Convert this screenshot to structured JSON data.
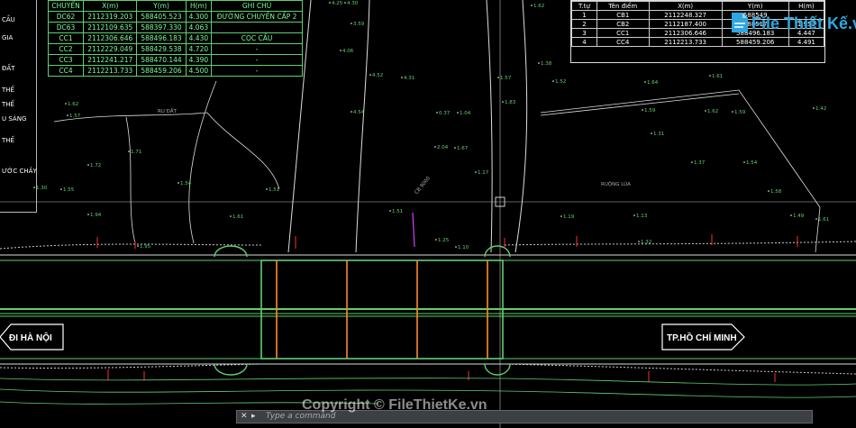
{
  "left_table": {
    "header": {
      "c1": "CHUYỂN",
      "c2": "X(m)",
      "c3": "Y(m)",
      "c4": "H(m)",
      "c5": "GHI CHÚ"
    },
    "rows": [
      {
        "c1": "DC62",
        "c2": "2112319.203",
        "c3": "588405.523",
        "c4": "4.300",
        "c5": "ĐƯỜNG CHUYỀN CẤP 2"
      },
      {
        "c1": "DC63",
        "c2": "2112109.635",
        "c3": "588397.330",
        "c4": "4.063",
        "c5": ""
      },
      {
        "c1": "CC1",
        "c2": "2112306.646",
        "c3": "588496.183",
        "c4": "4.430",
        "c5": "CỌC CẦU"
      },
      {
        "c1": "CC2",
        "c2": "2112229.049",
        "c3": "588429.538",
        "c4": "4.720",
        "c5": "-"
      },
      {
        "c1": "CC3",
        "c2": "2112241.217",
        "c3": "588470.144",
        "c4": "4.390",
        "c5": "-"
      },
      {
        "c1": "CC4",
        "c2": "2112213.733",
        "c3": "588459.206",
        "c4": "4.500",
        "c5": "-"
      }
    ]
  },
  "right_table": {
    "header": {
      "c1": "T.tự",
      "c2": "Tên điểm",
      "c3": "X(m)",
      "c4": "Y(m)",
      "c5": "H(m)"
    },
    "rows": [
      {
        "c1": "1",
        "c2": "CB1",
        "c3": "2112248.327",
        "c4": "588549",
        "c5": ""
      },
      {
        "c1": "2",
        "c2": "CB2",
        "c3": "2112187.400",
        "c4": "588517",
        "c5": "1.953"
      },
      {
        "c1": "3",
        "c2": "CC1",
        "c3": "2112306.646",
        "c4": "588496.183",
        "c5": "4.447"
      },
      {
        "c1": "4",
        "c2": "CC4",
        "c3": "2112213.733",
        "c4": "588459.206",
        "c5": "4.491"
      }
    ]
  },
  "side_panel": [
    "CẦU",
    "GIA",
    "ĐẤT",
    "THẾ",
    "THẾ",
    "U SÁNG",
    "THẾ",
    "ƯỚC CHẢY"
  ],
  "labels": {
    "left_direction": "ĐI HÀ NỘI",
    "right_direction": "TP.HỒ CHÍ MINH",
    "rice_field_left": "RU ĐẤT",
    "rice_field_right": "RUỘNG LÚA",
    "bench": "CB 9000"
  },
  "elevations": [
    "1.62",
    "1.57",
    "1.30",
    "1.72",
    "1.71",
    "1.55",
    "1.94",
    "1.95",
    "1.54",
    "1.61",
    "1.51",
    "4.25",
    "4.30",
    "3.59",
    "4.06",
    "4.52",
    "4.31",
    "4.54",
    "0.37",
    "1.04",
    "2.04",
    "1.67",
    "1.51",
    "1.25",
    "1.10",
    "1.17",
    "1.57",
    "1.83",
    "1.62",
    "1.38",
    "1.52",
    "1.64",
    "1.61",
    "1.59",
    "1.62",
    "1.59",
    "1.42",
    "1.31",
    "1.37",
    "1.19",
    "1.13",
    "1.32",
    "1.54",
    "1.58",
    "1.49",
    "1.61"
  ],
  "command_bar": {
    "placeholder": "Type a command"
  },
  "watermark": {
    "logo": "File Thiết Kế.vn",
    "copyright": "Copyright © FileThietKe.vn"
  },
  "colors": {
    "green": "#5fd06f",
    "orange": "#ff8a2a",
    "red": "#ff3030",
    "white": "#ffffff",
    "magenta": "#d040ff"
  }
}
